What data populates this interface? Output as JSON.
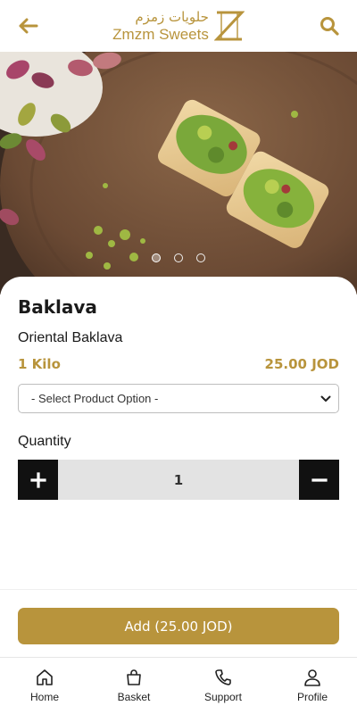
{
  "brand": {
    "name_ar": "حلويات زمزم",
    "name_en": "Zmzm Sweets",
    "accent_color": "#b8943c"
  },
  "header": {
    "back_icon": "arrow-left-icon",
    "search_icon": "search-icon"
  },
  "carousel": {
    "slide_count": 3,
    "active_index": 0
  },
  "product": {
    "title": "Baklava",
    "subtitle": "Oriental Baklava",
    "unit": "1 Kilo",
    "price": "25.00 JOD"
  },
  "option_select": {
    "selected": "- Select Product Option -"
  },
  "quantity": {
    "label": "Quantity",
    "value": "1"
  },
  "add_button": {
    "label": "Add (25.00 JOD)"
  },
  "nav": {
    "items": [
      {
        "label": "Home",
        "icon": "home-icon"
      },
      {
        "label": "Basket",
        "icon": "basket-icon"
      },
      {
        "label": "Support",
        "icon": "phone-icon"
      },
      {
        "label": "Profile",
        "icon": "user-icon"
      }
    ]
  }
}
